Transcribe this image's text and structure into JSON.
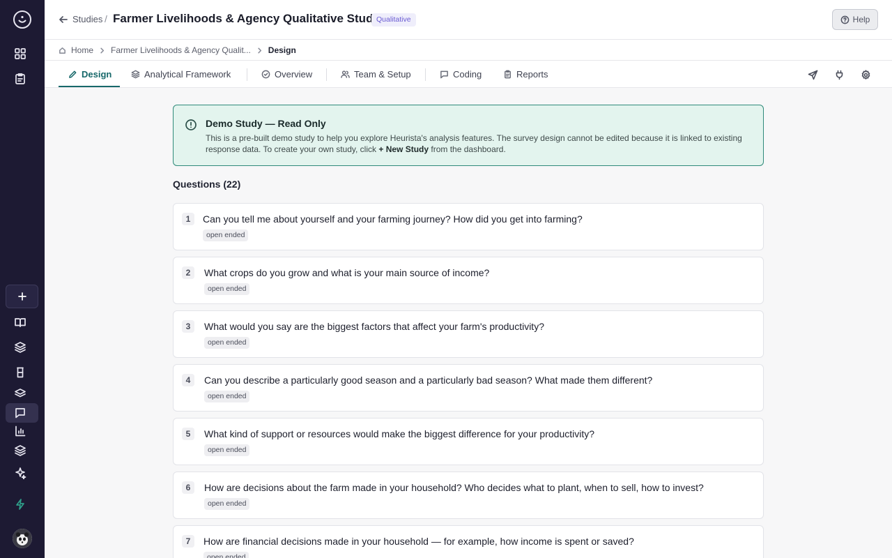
{
  "header": {
    "back_label": "Studies",
    "separator": "/",
    "title": "Farmer Livelihoods & Agency Qualitative Study",
    "badge": "Qualitative",
    "help_label": "Help"
  },
  "breadcrumb": {
    "home": "Home",
    "study": "Farmer Livelihoods & Agency Qualit...",
    "current": "Design"
  },
  "tabs": [
    {
      "label": "Design",
      "icon": "pencil-icon",
      "active": true
    },
    {
      "label": "Analytical Framework",
      "icon": "layers-icon"
    },
    {
      "label": "Overview",
      "icon": "check-circle-icon"
    },
    {
      "label": "Team & Setup",
      "icon": "users-icon"
    },
    {
      "label": "Coding",
      "icon": "message-icon"
    },
    {
      "label": "Reports",
      "icon": "clipboard-icon"
    }
  ],
  "toolbar_icons": [
    "send-icon",
    "plug-icon",
    "gear-icon"
  ],
  "notice": {
    "title": "Demo Study — Read Only",
    "body_prefix": "This is a pre-built demo study to help you explore Heurista's analysis features. The survey design cannot be edited because it is linked to existing response data. To create your own study, click ",
    "body_bold": "+ New Study",
    "body_suffix": " from the dashboard."
  },
  "questions_heading": "Questions (22)",
  "questions": [
    {
      "num": "1",
      "text": "Can you tell me about yourself and your farming journey? How did you get into farming?",
      "tag": "open ended"
    },
    {
      "num": "2",
      "text": "What crops do you grow and what is your main source of income?",
      "tag": "open ended"
    },
    {
      "num": "3",
      "text": "What would you say are the biggest factors that affect your farm's productivity?",
      "tag": "open ended"
    },
    {
      "num": "4",
      "text": "Can you describe a particularly good season and a particularly bad season? What made them different?",
      "tag": "open ended"
    },
    {
      "num": "5",
      "text": "What kind of support or resources would make the biggest difference for your productivity?",
      "tag": "open ended"
    },
    {
      "num": "6",
      "text": "How are decisions about the farm made in your household? Who decides what to plant, when to sell, how to invest?",
      "tag": "open ended"
    },
    {
      "num": "7",
      "text": "How are financial decisions made in your household — for example, how income is spent or saved?",
      "tag": "open ended"
    }
  ],
  "colors": {
    "rail": "#1d1a33",
    "accent": "#17686a",
    "notice_bg": "#e3f4ee",
    "notice_border": "#2f8a7a",
    "badge_text": "#6a5bd2"
  }
}
